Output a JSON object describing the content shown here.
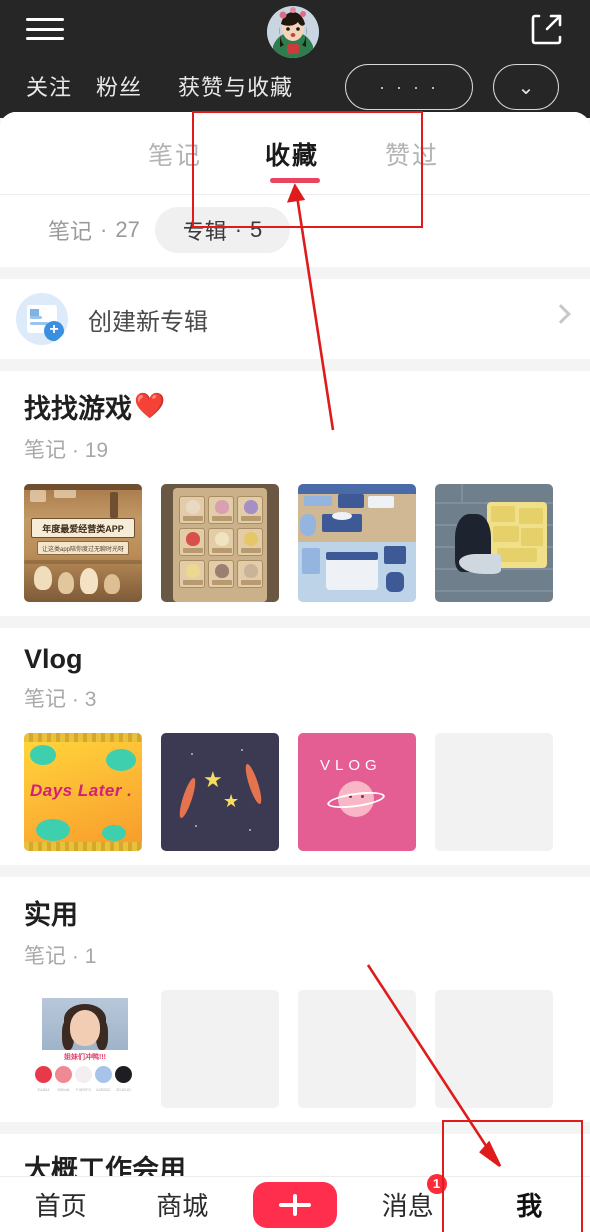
{
  "header": {
    "menu_icon": "hamburger-icon",
    "avatar_icon": "user-avatar",
    "share_icon": "share-external-icon",
    "stats": [
      {
        "label": "关注"
      },
      {
        "label": "粉丝"
      },
      {
        "label": "获赞与收藏"
      }
    ],
    "edit_button": "· · · ·",
    "settings_button": "⌄"
  },
  "tabs": {
    "items": [
      {
        "label": "笔记",
        "active": false
      },
      {
        "label": "收藏",
        "active": true
      },
      {
        "label": "赞过",
        "active": false
      }
    ],
    "accent_color": "#e94560"
  },
  "chips": [
    {
      "label": "笔记",
      "dot": "·",
      "count": "27",
      "selected": false
    },
    {
      "label": "专辑",
      "dot": "·",
      "count": "5",
      "selected": true
    }
  ],
  "create_album": {
    "icon": "create-album-icon",
    "label": "创建新专辑",
    "chevron": "chevron-right-icon"
  },
  "albums": [
    {
      "title": "找找游戏",
      "emoji": "❤️",
      "count_label": "笔记",
      "dot": "·",
      "count": "19",
      "thumbs": [
        "sepia-game-poster",
        "character-grid",
        "isometric-room",
        "wall-notes"
      ],
      "thumb_texts": {
        "poster_title": "年度最爱经营类APP",
        "poster_sub": "让这类app陪你度过无聊时光呀"
      }
    },
    {
      "title": "Vlog",
      "emoji": "",
      "count_label": "笔记",
      "dot": "·",
      "count": "3",
      "thumbs": [
        "days-later-cover",
        "stars-cover",
        "vlog-planet-cover",
        "empty-placeholder"
      ],
      "thumb_texts": {
        "days_title": "Days Later .",
        "vlog_title": "VLOG"
      }
    },
    {
      "title": "实用",
      "emoji": "",
      "count_label": "笔记",
      "dot": "·",
      "count": "1",
      "thumbs": [
        "color-palette-card",
        "empty-placeholder",
        "empty-placeholder",
        "empty-placeholder"
      ],
      "thumb_texts": {
        "palette_caption": "姐妹们冲鸭!!!",
        "swatch_colors": [
          "#e8394a",
          "#ef8a94",
          "#f4eef0",
          "#a8c3e8",
          "#1d1d22"
        ],
        "swatch_labels": [
          "EA834",
          "E864A",
          "F4EEF0",
          "A2B53C",
          "2D1D1D"
        ]
      }
    }
  ],
  "cut_off_album_title": "大概工作会用",
  "bottom_nav": {
    "items": [
      {
        "label": "首页",
        "active": false,
        "badge": ""
      },
      {
        "label": "商城",
        "active": false,
        "badge": ""
      },
      {
        "label": "消息",
        "active": false,
        "badge": "1"
      },
      {
        "label": "我",
        "active": true,
        "badge": ""
      }
    ],
    "plus_button": "add-post-button",
    "plus_color": "#ff2e4d"
  },
  "annotations": {
    "color": "#e01b1b",
    "box_tabs": "highlight-box-collect-tab",
    "box_nav": "highlight-box-me-tab",
    "arrow_tabs": "arrow-to-collect-tab",
    "arrow_nav": "arrow-to-me-tab"
  }
}
